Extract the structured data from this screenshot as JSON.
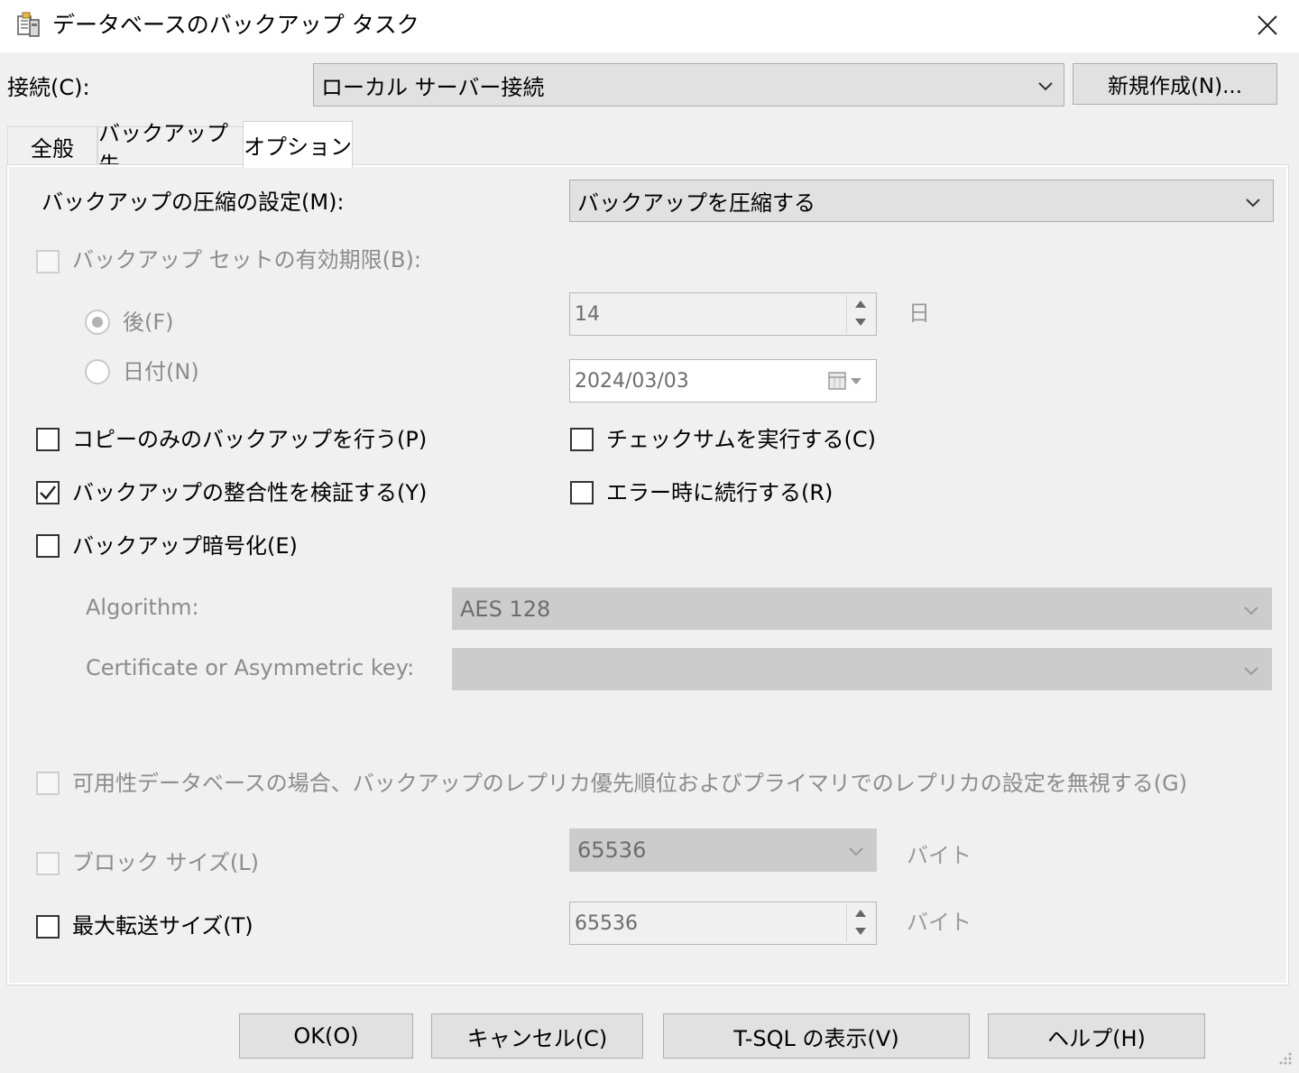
{
  "window": {
    "title": "データベースのバックアップ タスク"
  },
  "connection": {
    "label": "接続(C):",
    "value": "ローカル サーバー接続",
    "new_button": "新規作成(N)..."
  },
  "tabs": [
    {
      "label": "全般",
      "selected": false
    },
    {
      "label": "バックアップ先",
      "selected": false
    },
    {
      "label": "オプション",
      "selected": true
    }
  ],
  "options": {
    "compression": {
      "label": "バックアップの圧縮の設定(M):",
      "value": "バックアップを圧縮する"
    },
    "expiration": {
      "label": "バックアップ セットの有効期限(B):",
      "checked": false,
      "after_label": "後(F)",
      "after_value": "14",
      "after_unit": "日",
      "date_label": "日付(N)",
      "date_value": "2024/03/03"
    },
    "copy_only": {
      "label": "コピーのみのバックアップを行う(P)",
      "checked": false
    },
    "checksum": {
      "label": "チェックサムを実行する(C)",
      "checked": false
    },
    "verify": {
      "label": "バックアップの整合性を検証する(Y)",
      "checked": true
    },
    "continue_on_error": {
      "label": "エラー時に続行する(R)",
      "checked": false
    },
    "encrypt": {
      "label": "バックアップ暗号化(E)",
      "checked": false
    },
    "algorithm": {
      "label": "Algorithm:",
      "value": "AES 128"
    },
    "certificate": {
      "label": "Certificate or Asymmetric key:",
      "value": ""
    },
    "availability": {
      "label": "可用性データベースの場合、バックアップのレプリカ優先順位およびプライマリでのレプリカの設定を無視する(G)",
      "checked": false
    },
    "block_size": {
      "label": "ブロック サイズ(L)",
      "value": "65536",
      "unit": "バイト",
      "checked": false
    },
    "max_transfer": {
      "label": "最大転送サイズ(T)",
      "value": "65536",
      "unit": "バイト",
      "checked": false
    }
  },
  "buttons": {
    "ok": "OK(O)",
    "cancel": "キャンセル(C)",
    "tsql": "T-SQL の表示(V)",
    "help": "ヘルプ(H)"
  }
}
